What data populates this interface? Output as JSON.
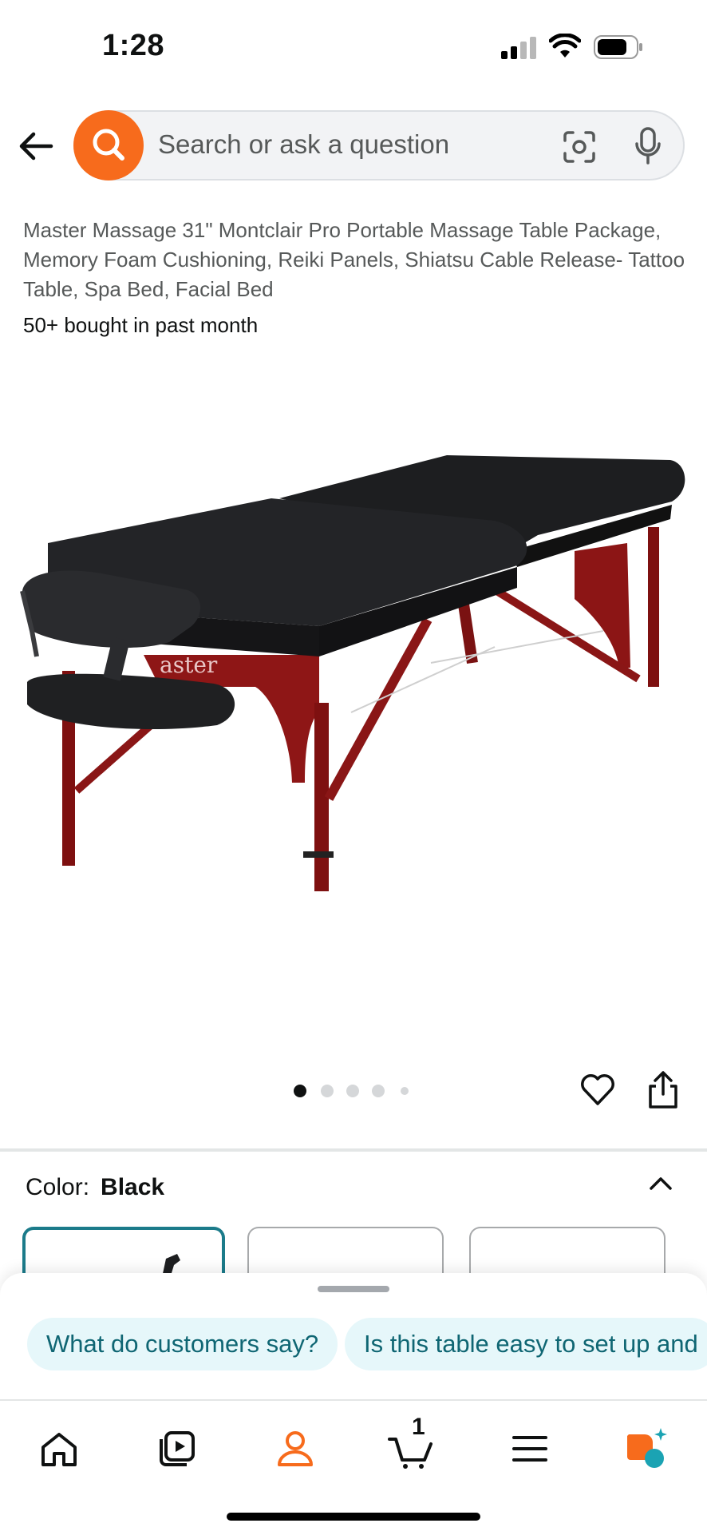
{
  "status_bar": {
    "time": "1:28"
  },
  "search": {
    "placeholder": "Search or ask a question"
  },
  "product": {
    "title": "Master Massage 31\" Montclair Pro Portable Massage Table Package, Memory Foam Cushioning, Reiki Panels, Shiatsu Cable Release- Tattoo Table, Spa Bed, Facial Bed",
    "bought": "50+ bought in past month",
    "image_dots": 5,
    "active_dot": 1
  },
  "variant": {
    "label": "Color:",
    "value": "Black"
  },
  "assistant": {
    "chips": [
      "What do customers say?",
      "Is this table easy to set up and"
    ]
  },
  "nav": {
    "cart_count": "1"
  },
  "colors": {
    "accent_orange": "#f76b1c",
    "chip_bg": "#e6f7fa",
    "chip_text": "#0f6673",
    "selected_border": "#1b7b8a"
  }
}
